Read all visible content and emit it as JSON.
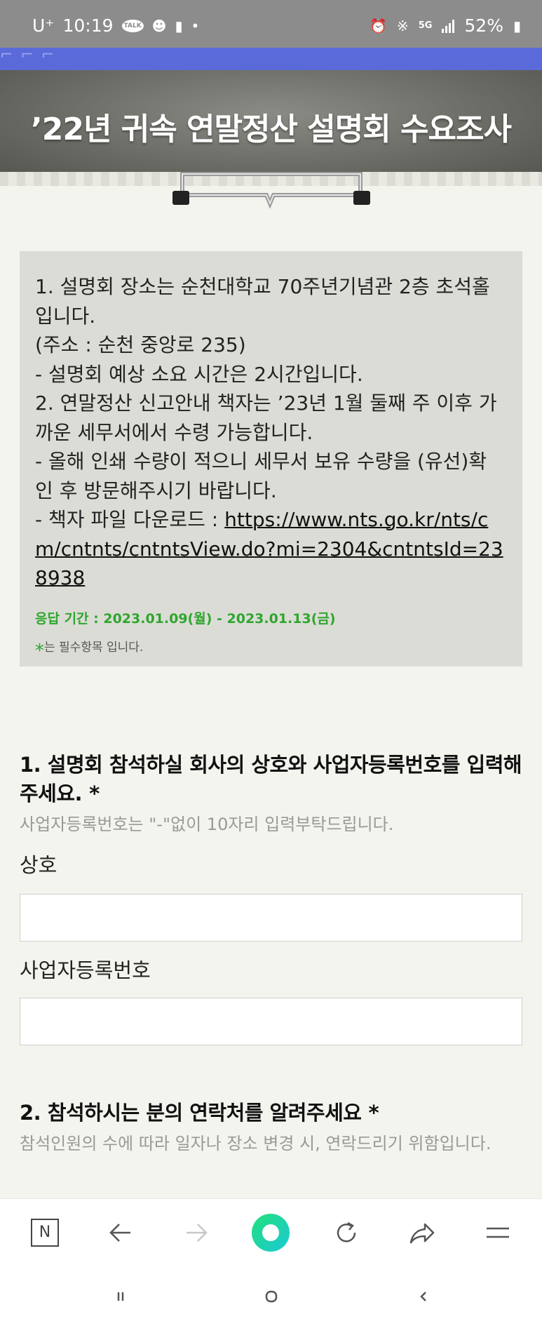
{
  "status_bar": {
    "carrier": "U⁺",
    "time": "10:19",
    "talk_badge": "TALK",
    "network": "5G",
    "battery": "52%"
  },
  "header": {
    "title": "’22년 귀속 연말정산 설명회 수요조사"
  },
  "notice": {
    "body": "1. 설명회 장소는 순천대학교 70주년기념관 2층 초석홀입니다.\n(주소 : 순천 중앙로 235)\n- 설명회 예상 소요 시간은 2시간입니다.\n2. 연말정산 신고안내 책자는 ’23년 1월 둘째 주 이후 가까운 세무서에서 수령 가능합니다.\n- 올해 인쇄 수량이 적으니 세무서 보유 수량을 (유선)확인 후 방문해주시기 바랍니다.\n- 책자 파일 다운로드 : ",
    "link": "https://www.nts.go.kr/nts/cm/cntnts/cntntsView.do?mi=2304&cntntsId=238938",
    "period": "응답 기간 : 2023.01.09(월) - 2023.01.13(금)",
    "required_star": "*",
    "required_note": "는 필수항목 입니다."
  },
  "questions": [
    {
      "title": "1. 설명회 참석하실 회사의 상호와 사업자등록번호를 입력해주세요.",
      "star": "*",
      "description": "사업자등록번호는 \"-\"없이 10자리 입력부탁드립니다.",
      "fields": [
        {
          "label": "상호",
          "value": ""
        },
        {
          "label": "사업자등록번호",
          "value": ""
        }
      ]
    },
    {
      "title": "2. 참석하시는 분의 연락처를 알려주세요",
      "star": "*",
      "description": "참석인원의 수에 따라 일자나 장소 변경 시, 연락드리기 위함입니다."
    }
  ],
  "browser_nav": {
    "home_letter": "N"
  },
  "colors": {
    "accent_green": "#2ea62e",
    "top_strip_blue": "#5a6bd9",
    "browser_green": "#1ed9a4"
  }
}
